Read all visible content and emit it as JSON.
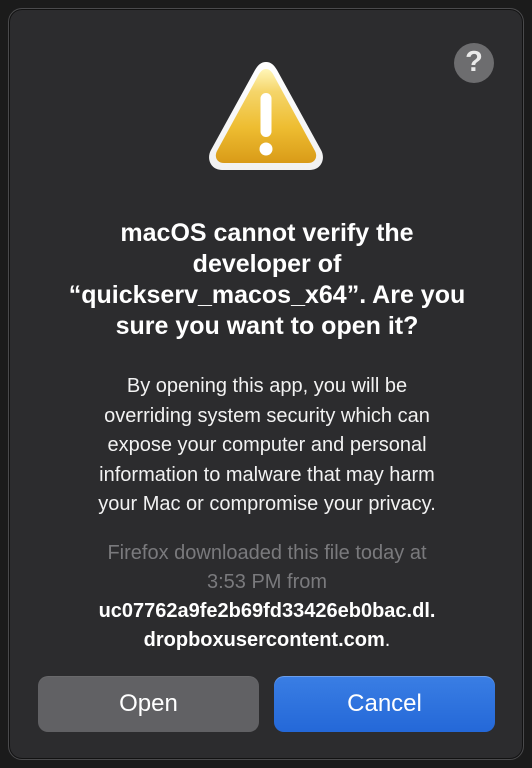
{
  "dialog": {
    "help_symbol": "?",
    "warning_icon_name": "warning-triangle-icon",
    "title_lines": [
      "macOS cannot verify the",
      "developer of",
      "“quickserv_macos_x64”. Are you",
      "sure you want to open it?"
    ],
    "message_lines": [
      "By opening this app, you will be",
      "overriding system security which can",
      "expose your computer and personal",
      "information to malware that may harm",
      "your Mac or compromise your privacy."
    ],
    "download_info_lines": [
      "Firefox downloaded this file today at",
      "3:53 PM from"
    ],
    "download_source_lines": [
      "uc07762a9fe2b69fd33426eb0bac.dl.",
      "dropboxusercontent.com"
    ],
    "download_source_suffix": ".",
    "buttons": {
      "open": "Open",
      "cancel": "Cancel"
    },
    "colors": {
      "dialog_background": "#2c2c2e",
      "primary_button": "#2e6ed4",
      "secondary_button": "#616164",
      "warning_yellow": "#f2c94c"
    }
  }
}
